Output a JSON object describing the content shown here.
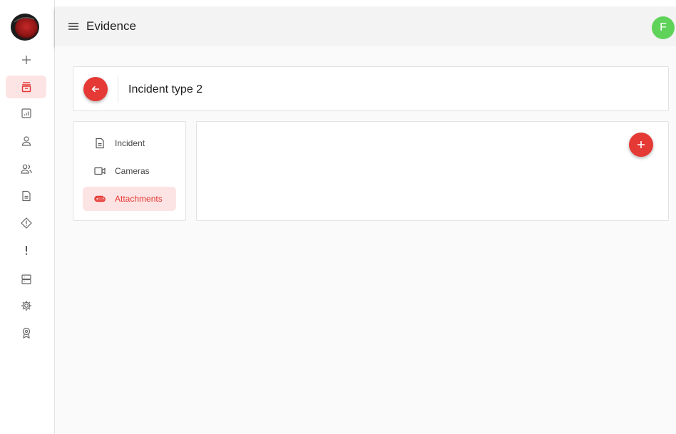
{
  "colors": {
    "accent": "#e53935",
    "active_bg": "#fde4e4",
    "avatar_bg": "#5fd25a",
    "topbar_bg": "#f3f3f3",
    "content_bg": "#fafafa"
  },
  "topbar": {
    "menu_icon": "hamburger-menu-icon",
    "title": "Evidence",
    "avatar_initial": "F"
  },
  "rail": {
    "logo": "brand-logo",
    "items": [
      {
        "icon": "plus-icon",
        "active": false
      },
      {
        "icon": "evidence-box-icon",
        "active": true
      },
      {
        "icon": "report-chart-icon",
        "active": false
      },
      {
        "icon": "person-icon",
        "active": false
      },
      {
        "icon": "people-icon",
        "active": false
      },
      {
        "icon": "document-icon",
        "active": false
      },
      {
        "icon": "warning-diamond-icon",
        "active": false
      },
      {
        "icon": "exclamation-icon",
        "active": false
      },
      {
        "icon": "server-icon",
        "active": false
      },
      {
        "icon": "gear-icon",
        "active": false
      },
      {
        "icon": "badge-icon",
        "active": false
      }
    ]
  },
  "header": {
    "back_icon": "arrow-left-icon",
    "title": "Incident type 2"
  },
  "nav": {
    "items": [
      {
        "label": "Incident",
        "icon": "document-icon",
        "active": false
      },
      {
        "label": "Cameras",
        "icon": "video-camera-icon",
        "active": false
      },
      {
        "label": "Attachments",
        "icon": "paperclip-icon",
        "active": true
      }
    ]
  },
  "main": {
    "add_icon": "plus-icon"
  }
}
